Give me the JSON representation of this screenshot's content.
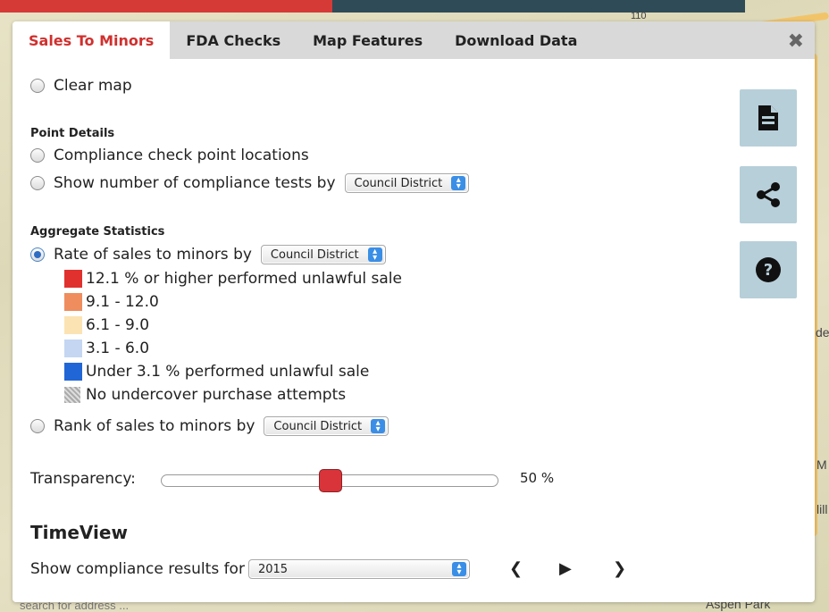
{
  "map": {
    "road_label": "110",
    "labels": [
      "de",
      "M",
      "lill",
      "Aspen Park"
    ],
    "search_placeholder": "search for address ..."
  },
  "tabs": [
    {
      "label": "Sales To Minors",
      "active": true
    },
    {
      "label": "FDA Checks",
      "active": false
    },
    {
      "label": "Map Features",
      "active": false
    },
    {
      "label": "Download Data",
      "active": false
    }
  ],
  "close_icon": "close-icon",
  "clear_map": {
    "label": "Clear map",
    "checked": false
  },
  "point_details": {
    "heading": "Point Details",
    "options": [
      {
        "label": "Compliance check point locations",
        "checked": false
      },
      {
        "label": "Show number of compliance tests by",
        "checked": false,
        "select": "Council District"
      }
    ]
  },
  "aggregate": {
    "heading": "Aggregate Statistics",
    "rate": {
      "label": "Rate of sales to minors by",
      "checked": true,
      "select": "Council District"
    },
    "legend": [
      {
        "label": "12.1 % or higher performed unlawful sale",
        "color": "#e0312f"
      },
      {
        "label": "9.1 - 12.0",
        "color": "#ef8d5e"
      },
      {
        "label": "6.1 - 9.0",
        "color": "#fce3b3"
      },
      {
        "label": "3.1 - 6.0",
        "color": "#c5d6f3"
      },
      {
        "label": "Under 3.1 % performed unlawful sale",
        "color": "#2166d6"
      },
      {
        "label": "No undercover purchase attempts",
        "color": "hatch"
      }
    ],
    "rank": {
      "label": "Rank of sales to minors by",
      "checked": false,
      "select": "Council District"
    }
  },
  "transparency": {
    "label": "Transparency:",
    "value_text": "50 %",
    "value": 0.5
  },
  "timeview": {
    "heading": "TimeView",
    "label": "Show compliance results for",
    "select": "2015",
    "prev_icon": "chevron-left-icon",
    "play_icon": "play-icon",
    "next_icon": "chevron-right-icon"
  },
  "side_buttons": [
    "document-icon",
    "share-icon",
    "help-icon"
  ],
  "colors": {
    "accent_red": "#d0302e",
    "side_button_bg": "#b7cfd9",
    "slider_thumb": "#d9343a"
  }
}
